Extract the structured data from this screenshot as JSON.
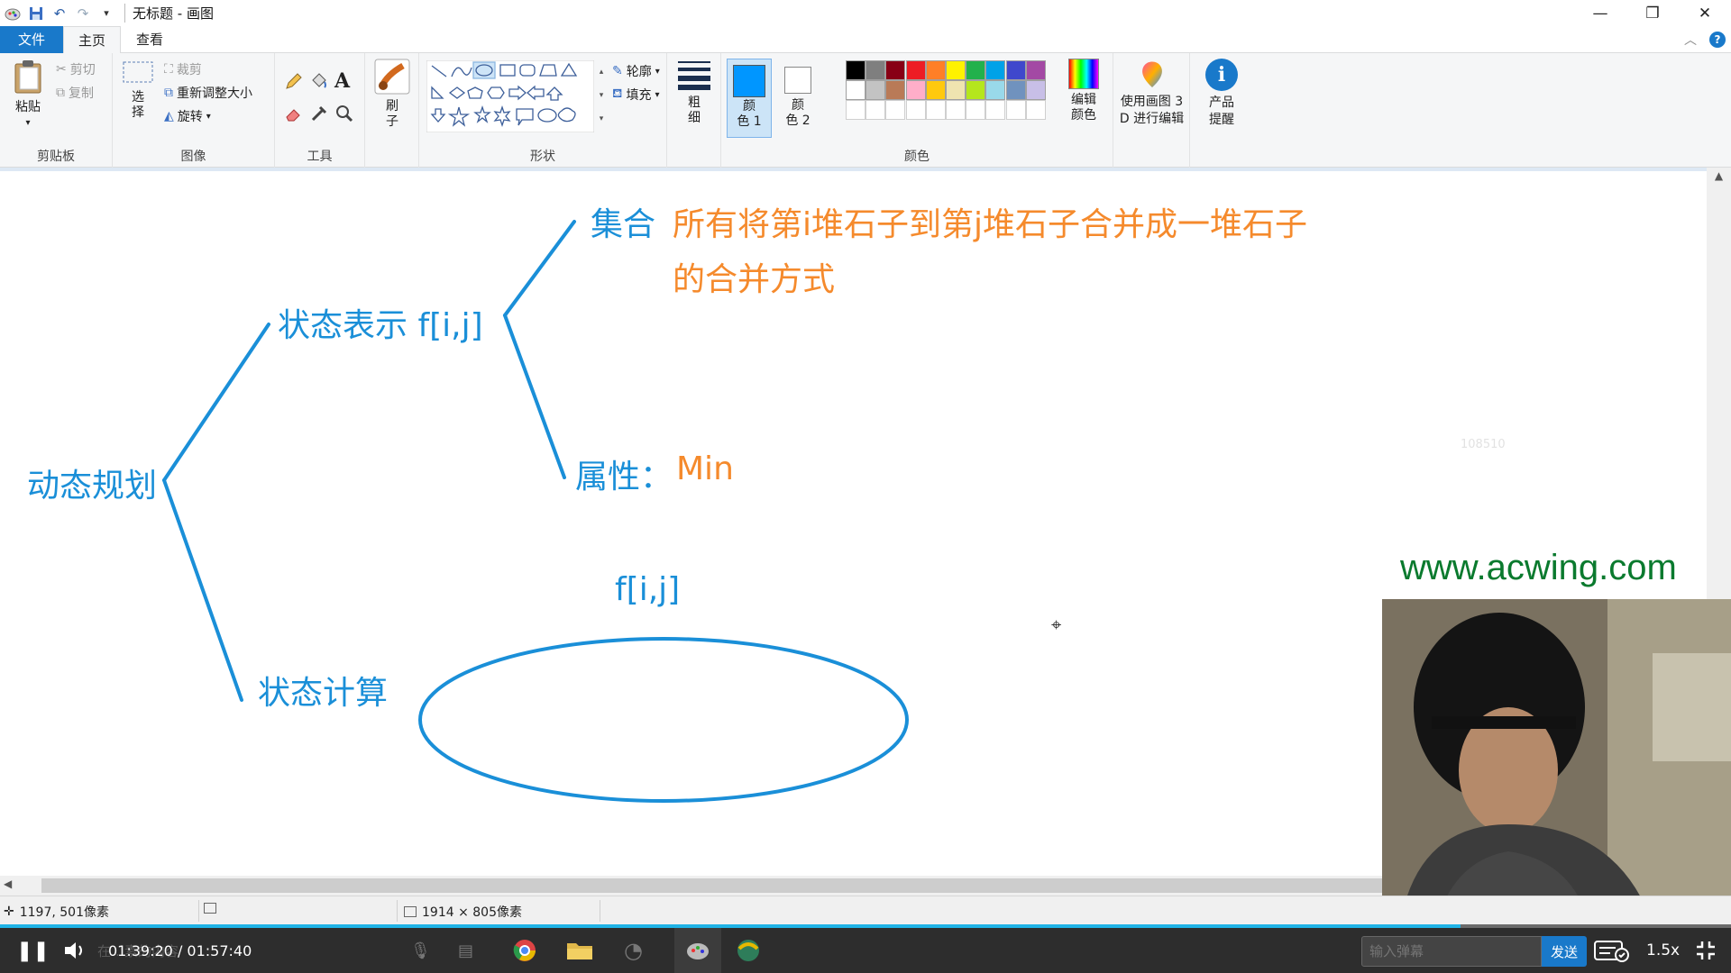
{
  "window": {
    "title": "无标题 - 画图"
  },
  "tabs": {
    "file": "文件",
    "home": "主页",
    "view": "查看"
  },
  "clipboard": {
    "paste": "粘贴",
    "cut": "剪切",
    "copy": "复制",
    "group": "剪贴板"
  },
  "image": {
    "select": "选\n择",
    "crop": "裁剪",
    "resize": "重新调整大小",
    "rotate": "旋转",
    "group": "图像"
  },
  "tools": {
    "group": "工具"
  },
  "brush": {
    "label": "刷\n子"
  },
  "shapes": {
    "outline": "轮廓",
    "fill": "填充",
    "group": "形状"
  },
  "size": {
    "label": "粗\n细"
  },
  "colors": {
    "color1": "颜\n色 1",
    "color2": "颜\n色 2",
    "edit": "编辑\n颜色",
    "group": "颜色",
    "palette_row1": [
      "#000000",
      "#7f7f7f",
      "#880015",
      "#ed1c24",
      "#ff7f27",
      "#fff200",
      "#22b14c",
      "#00a2e8",
      "#3f48cc",
      "#a349a4"
    ],
    "palette_row2": [
      "#ffffff",
      "#c3c3c3",
      "#b97a57",
      "#ffaec9",
      "#ffc90e",
      "#efe4b0",
      "#b5e61d",
      "#99d9ea",
      "#7092be",
      "#c8bfe7"
    ],
    "primary": "#0096ff"
  },
  "paint3d": {
    "label": "使用画图 3\nD 进行编辑"
  },
  "product": {
    "label": "产品\n提醒"
  },
  "drawing": {
    "root": "动态规划",
    "state_repr": "状态表示 f[i,j]",
    "set_label": "集合",
    "set_desc_1": "所有将第i堆石子到第j堆石子合并成一堆石子",
    "set_desc_2": "的合并方式",
    "attr_label": "属性：",
    "attr_value": "Min",
    "state_calc": "状态计算",
    "fij": "f[i,j]",
    "blue": "#1a8fd8",
    "orange": "#f58a2c"
  },
  "watermark": {
    "site": "www.acwing.com",
    "id": "108510"
  },
  "status": {
    "cursor": "1197, 501像素",
    "canvas_size": "1914 × 805像素"
  },
  "player": {
    "time": "01:39:20 / 01:57:40",
    "hidden_text": "在…素的内容",
    "danmu_placeholder": "输入弹幕",
    "send": "发送",
    "speed": "1.5x",
    "progress": 0.844
  }
}
